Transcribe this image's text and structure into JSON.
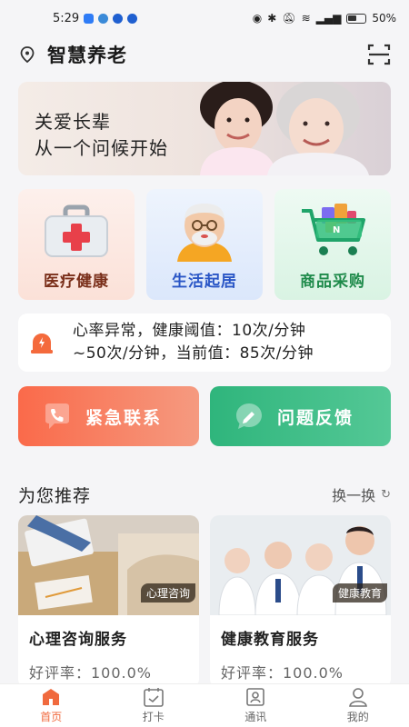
{
  "status_bar": {
    "time": "5:29",
    "battery": "50%"
  },
  "header": {
    "title": "智慧养老"
  },
  "banner": {
    "line1": "关爱长辈",
    "line2": "从一个问候开始"
  },
  "categories": [
    {
      "label": "医疗健康",
      "icon": "medical-kit-icon"
    },
    {
      "label": "生活起居",
      "icon": "elderly-man-icon"
    },
    {
      "label": "商品采购",
      "icon": "shopping-cart-icon"
    }
  ],
  "alert": {
    "line1": "心率异常，健康阈值：10次/分钟",
    "line2": "~50次/分钟，当前值：85次/分钟"
  },
  "actions": {
    "emergency": "紧急联系",
    "feedback": "问题反馈"
  },
  "recommend": {
    "title": "为您推荐",
    "refresh": "换一换",
    "cards": [
      {
        "tag": "心理咨询",
        "title": "心理咨询服务",
        "rating": "好评率：100.0%"
      },
      {
        "tag": "健康教育",
        "title": "健康教育服务",
        "rating": "好评率：100.0%"
      }
    ]
  },
  "tabs": [
    {
      "label": "首页",
      "icon": "home-icon"
    },
    {
      "label": "打卡",
      "icon": "calendar-icon"
    },
    {
      "label": "通讯",
      "icon": "contacts-icon"
    },
    {
      "label": "我的",
      "icon": "profile-icon"
    }
  ],
  "colors": {
    "accent": "#f06a3e",
    "green": "#2fb57c",
    "blue": "#2a56c6"
  }
}
